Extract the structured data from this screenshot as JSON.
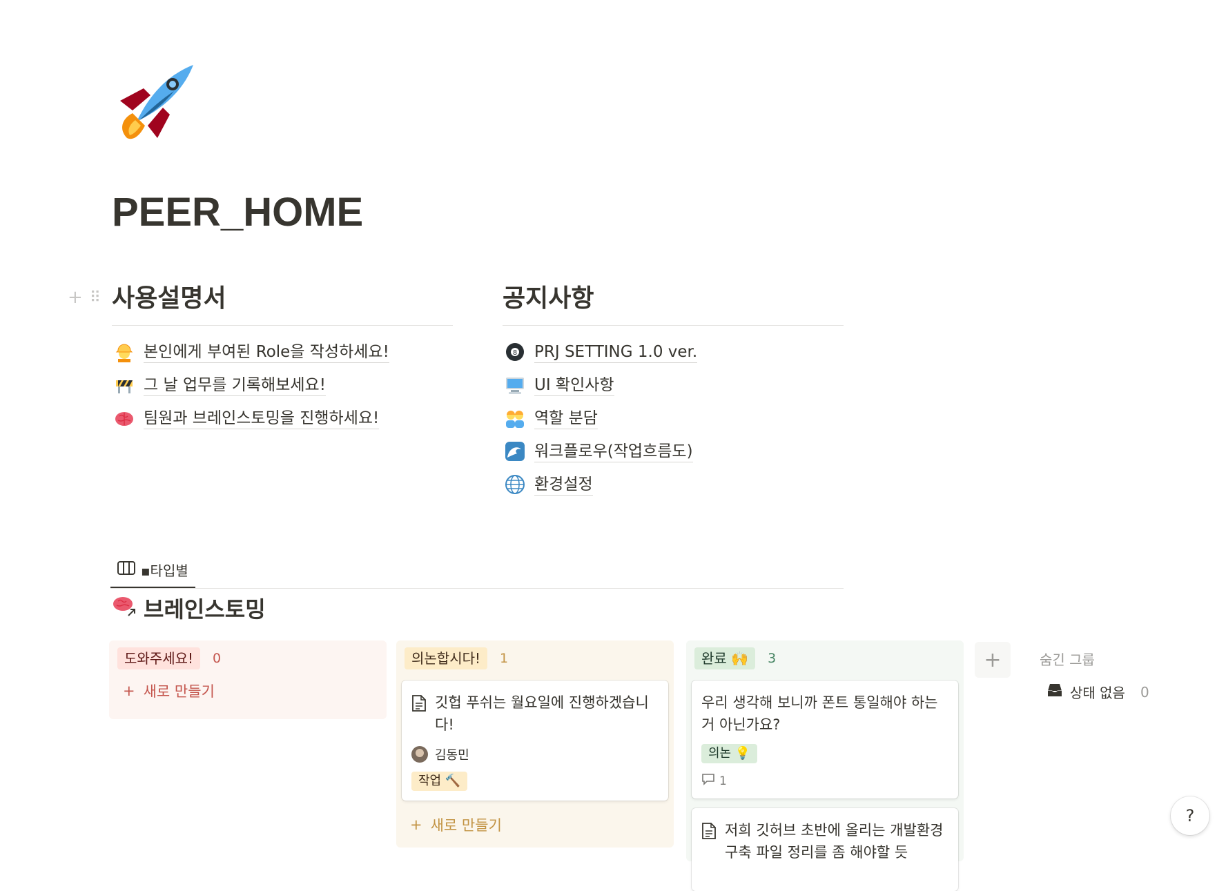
{
  "page": {
    "title": "PEER_HOME",
    "icon": "rocket-icon"
  },
  "columns": {
    "left": {
      "heading": "사용설명서",
      "items": [
        {
          "icon": "construction-worker-icon",
          "label": "본인에게 부여된 Role을 작성하세요!"
        },
        {
          "icon": "construction-barrier-icon",
          "label": "그 날 업무를 기록해보세요!"
        },
        {
          "icon": "brain-icon",
          "label": "팀원과 브레인스토밍을 진행하세요!"
        }
      ]
    },
    "right": {
      "heading": "공지사항",
      "items": [
        {
          "icon": "eight-ball-icon",
          "label": "PRJ SETTING 1.0 ver."
        },
        {
          "icon": "computer-icon",
          "label": "UI 확인사항"
        },
        {
          "icon": "people-icon",
          "label": "역할 분담"
        },
        {
          "icon": "wave-icon",
          "label": "워크플로우(작업흐름도)"
        },
        {
          "icon": "globe-icon",
          "label": "환경설정"
        }
      ]
    }
  },
  "database": {
    "view_tab": "▪타입별",
    "title": "브레인스토밍",
    "groups": [
      {
        "name": "도와주세요!",
        "count": "0",
        "new_label": "새로 만들기",
        "colors": {
          "bg": "#fdf5f2",
          "pill": "#ffe2dd",
          "text": "#c4554d"
        }
      },
      {
        "name": "의논합시다!",
        "count": "1",
        "new_label": "새로 만들기",
        "colors": {
          "bg": "#fbf6ec",
          "pill": "#fdecc8",
          "text": "#c29343"
        },
        "cards": [
          {
            "title": "깃헙 푸쉬는 월요일에 진행하겠습니다!",
            "person": "김동민",
            "tag": "작업 🔨"
          }
        ]
      },
      {
        "name": "완료 🙌",
        "count": "3",
        "colors": {
          "bg": "#f4f8f4",
          "pill": "#dbeddb",
          "text": "#448361"
        },
        "cards": [
          {
            "title": "우리 생각해 보니까 폰트 통일해야 하는거 아닌가요?",
            "tag": "의논 💡",
            "comments": "1"
          },
          {
            "title": "저희 깃허브 초반에 올리는 개발환경 구축 파일 정리를 좀 해야할 듯"
          }
        ]
      }
    ],
    "hidden_groups_label": "숨긴 그룹",
    "no_status": {
      "label": "상태 없음",
      "count": "0"
    }
  },
  "help": {
    "label": "?"
  }
}
